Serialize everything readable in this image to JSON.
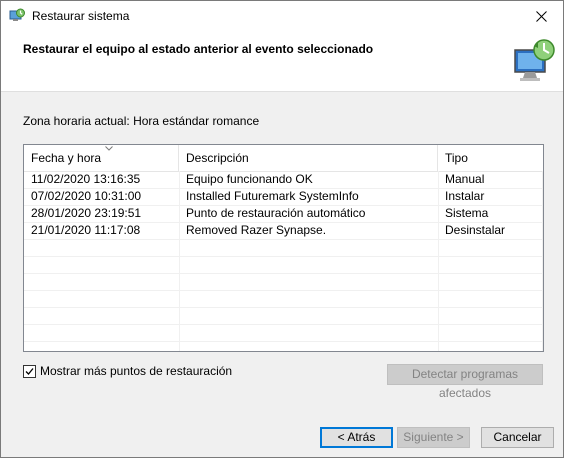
{
  "window": {
    "title": "Restaurar sistema"
  },
  "header": {
    "title": "Restaurar el equipo al estado anterior al evento seleccionado"
  },
  "timezone": {
    "label": "Zona horaria actual: Hora estándar romance"
  },
  "table": {
    "columns": [
      "Fecha y hora",
      "Descripción",
      "Tipo"
    ],
    "rows": [
      [
        "11/02/2020 13:16:35",
        "Equipo funcionando OK",
        "Manual"
      ],
      [
        "07/02/2020 10:31:00",
        "Installed Futuremark SystemInfo",
        "Instalar"
      ],
      [
        "28/01/2020 23:19:51",
        "Punto de restauración automático",
        "Sistema"
      ],
      [
        "21/01/2020 11:17:08",
        "Removed Razer Synapse.",
        "Desinstalar"
      ]
    ]
  },
  "show_more": {
    "label": "Mostrar más puntos de restauración",
    "checked": true
  },
  "buttons": {
    "detect": "Detectar programas afectados",
    "back": "< Atrás",
    "next": "Siguiente >",
    "cancel": "Cancelar"
  },
  "icons": {
    "title": "system-restore-icon",
    "close": "close-icon",
    "header": "restore-computer-icon",
    "sort": "sort-arrow-icon",
    "check": "checkmark-icon"
  }
}
